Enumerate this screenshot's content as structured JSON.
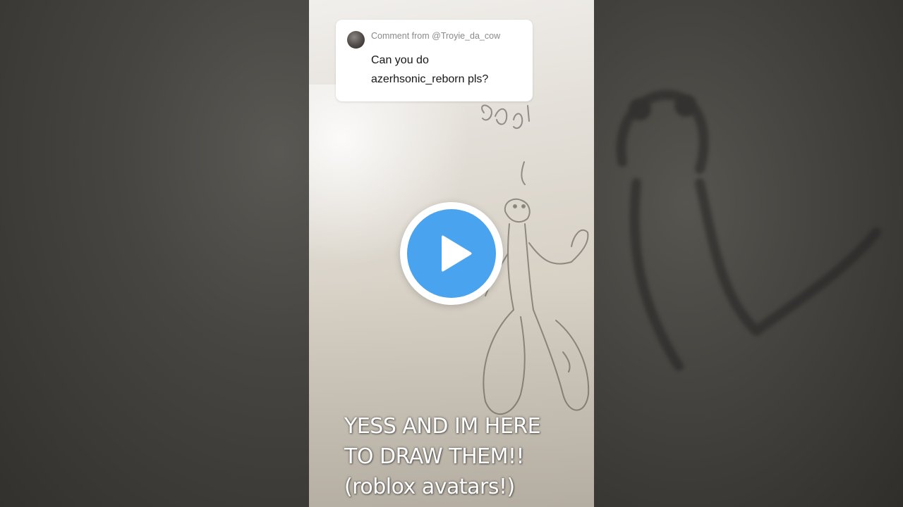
{
  "comment": {
    "header": "Comment from @Troyie_da_cow",
    "body_lines": [
      "Can you do",
      "azerhsonic_reborn pls?"
    ]
  },
  "caption": {
    "lines": [
      "YESS AND IM HERE",
      "TO DRAW THEM!!",
      "(roblox avatars!)"
    ]
  },
  "icons": {
    "play": "play-icon",
    "avatar": "commenter-avatar"
  },
  "colors": {
    "play_accent": "#4aa3ee",
    "card_background": "#ffffff",
    "caption_text": "#ffffff"
  }
}
